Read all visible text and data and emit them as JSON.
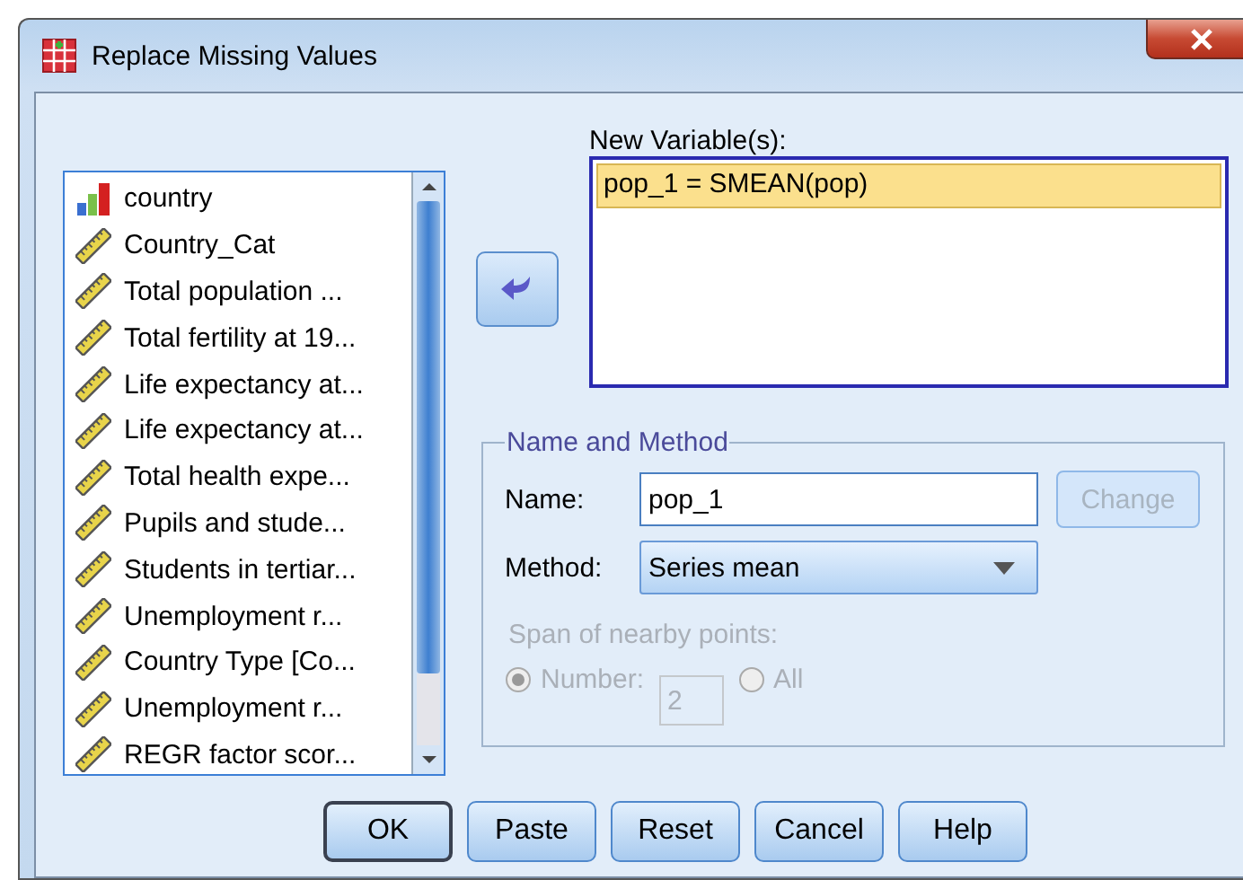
{
  "window": {
    "title": "Replace Missing Values"
  },
  "variables": [
    {
      "kind": "nominal",
      "name": "country"
    },
    {
      "kind": "scale",
      "name": "Country_Cat"
    },
    {
      "kind": "scale",
      "name": "Total population ..."
    },
    {
      "kind": "scale",
      "name": "Total fertility at 19..."
    },
    {
      "kind": "scale",
      "name": "Life expectancy at..."
    },
    {
      "kind": "scale",
      "name": "Life expectancy at..."
    },
    {
      "kind": "scale",
      "name": "Total health expe..."
    },
    {
      "kind": "scale",
      "name": "Pupils and stude..."
    },
    {
      "kind": "scale",
      "name": "Students in tertiar..."
    },
    {
      "kind": "scale",
      "name": "Unemployment r..."
    },
    {
      "kind": "scale",
      "name": "Country Type [Co..."
    },
    {
      "kind": "scale",
      "name": "Unemployment r..."
    },
    {
      "kind": "scale",
      "name": "REGR factor scor..."
    }
  ],
  "new_variables": {
    "label": "New Variable(s):",
    "items": [
      {
        "text": "pop_1 = SMEAN(pop)",
        "selected": true
      }
    ]
  },
  "name_and_method": {
    "title": "Name and Method",
    "name_label": "Name:",
    "name_value": "pop_1",
    "change_button": {
      "label": "Change",
      "disabled": true
    },
    "method_label": "Method:",
    "method_value": "Series mean",
    "span": {
      "label": "Span of nearby points:",
      "disabled": true,
      "number_value": "2",
      "options": [
        {
          "label": "Number:",
          "selected": true
        },
        {
          "label": "All",
          "selected": false
        }
      ]
    }
  },
  "buttons": [
    {
      "label": "OK",
      "default": true
    },
    {
      "label": "Paste",
      "default": false
    },
    {
      "label": "Reset",
      "default": false
    },
    {
      "label": "Cancel",
      "default": false
    },
    {
      "label": "Help",
      "default": false
    }
  ]
}
